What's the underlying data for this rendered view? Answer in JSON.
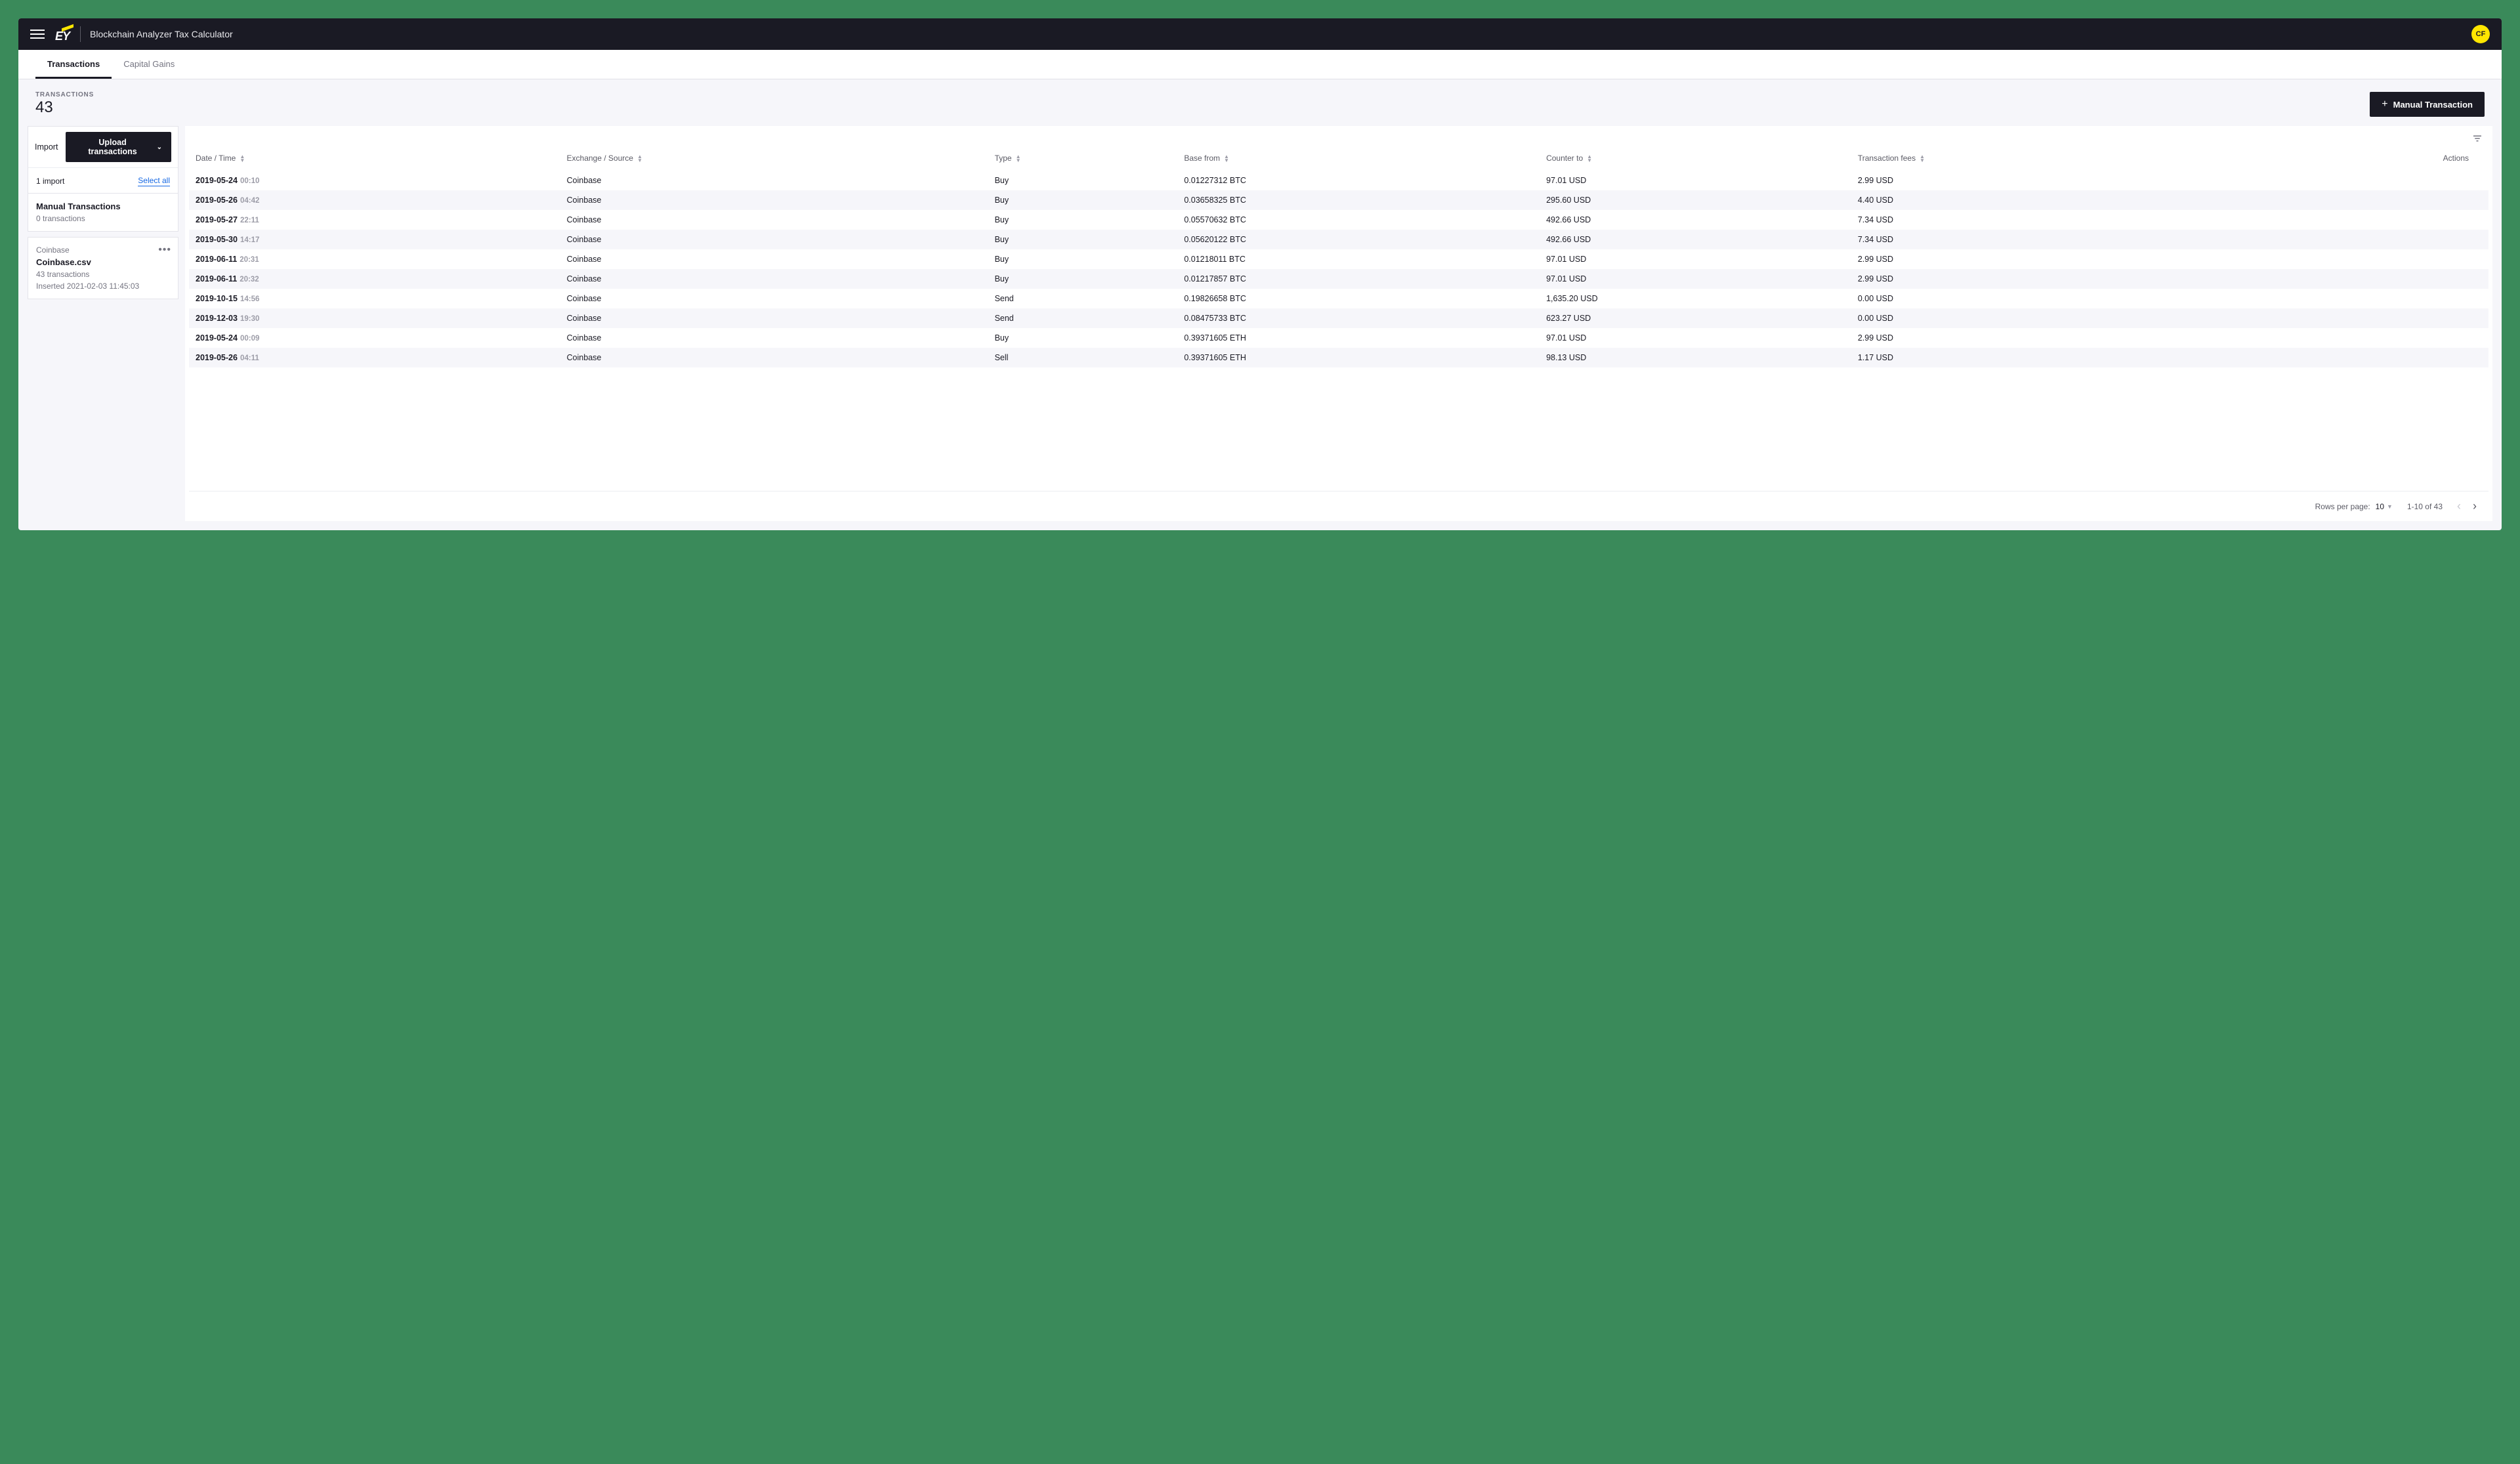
{
  "header": {
    "app_title": "Blockchain Analyzer Tax Calculator",
    "logo_text": "EY",
    "avatar_initials": "CF"
  },
  "tabs": [
    {
      "label": "Transactions",
      "active": true
    },
    {
      "label": "Capital Gains",
      "active": false
    }
  ],
  "sub_header": {
    "count_label": "TRANSACTIONS",
    "count_value": "43",
    "manual_btn_label": "Manual Transaction"
  },
  "sidebar": {
    "import_label": "Import",
    "upload_btn_label": "Upload transactions",
    "import_count_text": "1 import",
    "select_all_label": "Select all",
    "manual_tile": {
      "title": "Manual Transactions",
      "subtitle": "0 transactions"
    },
    "coinbase_tile": {
      "source": "Coinbase",
      "filename": "Coinbase.csv",
      "tx_count": "43 transactions",
      "inserted": "Inserted 2021-02-03 11:45:03"
    }
  },
  "table": {
    "columns": {
      "date": "Date / Time",
      "exchange": "Exchange / Source",
      "type": "Type",
      "base": "Base from",
      "counter": "Counter to",
      "fees": "Transaction fees",
      "actions": "Actions"
    },
    "rows": [
      {
        "date": "2019-05-24",
        "time": "00:10",
        "exchange": "Coinbase",
        "type": "Buy",
        "base": "0.01227312 BTC",
        "counter": "97.01 USD",
        "fees": "2.99 USD"
      },
      {
        "date": "2019-05-26",
        "time": "04:42",
        "exchange": "Coinbase",
        "type": "Buy",
        "base": "0.03658325 BTC",
        "counter": "295.60 USD",
        "fees": "4.40 USD"
      },
      {
        "date": "2019-05-27",
        "time": "22:11",
        "exchange": "Coinbase",
        "type": "Buy",
        "base": "0.05570632 BTC",
        "counter": "492.66 USD",
        "fees": "7.34 USD"
      },
      {
        "date": "2019-05-30",
        "time": "14:17",
        "exchange": "Coinbase",
        "type": "Buy",
        "base": "0.05620122 BTC",
        "counter": "492.66 USD",
        "fees": "7.34 USD"
      },
      {
        "date": "2019-06-11",
        "time": "20:31",
        "exchange": "Coinbase",
        "type": "Buy",
        "base": "0.01218011 BTC",
        "counter": "97.01 USD",
        "fees": "2.99 USD"
      },
      {
        "date": "2019-06-11",
        "time": "20:32",
        "exchange": "Coinbase",
        "type": "Buy",
        "base": "0.01217857 BTC",
        "counter": "97.01 USD",
        "fees": "2.99 USD"
      },
      {
        "date": "2019-10-15",
        "time": "14:56",
        "exchange": "Coinbase",
        "type": "Send",
        "base": "0.19826658 BTC",
        "counter": "1,635.20 USD",
        "fees": "0.00 USD"
      },
      {
        "date": "2019-12-03",
        "time": "19:30",
        "exchange": "Coinbase",
        "type": "Send",
        "base": "0.08475733 BTC",
        "counter": "623.27 USD",
        "fees": "0.00 USD"
      },
      {
        "date": "2019-05-24",
        "time": "00:09",
        "exchange": "Coinbase",
        "type": "Buy",
        "base": "0.39371605 ETH",
        "counter": "97.01 USD",
        "fees": "2.99 USD"
      },
      {
        "date": "2019-05-26",
        "time": "04:11",
        "exchange": "Coinbase",
        "type": "Sell",
        "base": "0.39371605 ETH",
        "counter": "98.13 USD",
        "fees": "1.17 USD"
      }
    ]
  },
  "pagination": {
    "rows_per_page_label": "Rows per page:",
    "rows_per_page_value": "10",
    "range_text": "1-10 of 43"
  }
}
